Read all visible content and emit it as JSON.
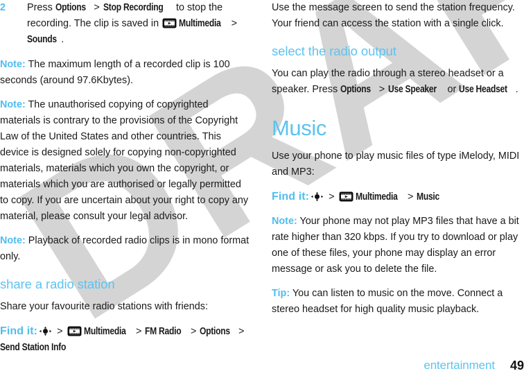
{
  "document": {
    "watermark": "DRAFT",
    "accent_blue": "#5cc3f0",
    "lead_blue": "#4fbdef",
    "body_color": "#1a1a1a",
    "watermark_color": "#d4d4d4"
  },
  "footer": {
    "chapter_name": "entertainment",
    "page_number": "49"
  },
  "left_column": {
    "step": {
      "number": "2",
      "line1_pre": "Press ",
      "line1_menu1": "Options",
      "line1_sep1": " > ",
      "line1_menu2": "Stop Recording",
      "line1_post": " to stop the recording.",
      "line2_pre": "The clip is saved in ",
      "line2_icon": "multimedia-icon",
      "line2_menu1": "Multimedia",
      "line2_sep1": " > ",
      "line2_menu2": "Sounds",
      "line2_post": "."
    },
    "note_1": {
      "lead": "Note:",
      "text": " The maximum length of a recorded clip is 100 seconds (around 97.6Kbytes)."
    },
    "note_2": {
      "lead": "Note:",
      "text": " The unauthorised copying of copyrighted materials is contrary to the provisions of the Copyright Law of the United States and other countries. This device is designed solely for copying non-copyrighted materials, materials which you own the copyright, or materials which you are authorised or legally permitted to copy. If you are uncertain about your right to copy any material, please consult your legal advisor."
    },
    "note_3": {
      "lead": "Note:",
      "text": " Playback of recorded radio clips is in mono format only."
    },
    "heading_share": "share a radio station",
    "share_intro": "Share your favourite radio stations with friends:",
    "find_it": {
      "lead": "Find it:",
      "nav_icon": "nav-key-icon",
      "sep1": " > ",
      "multimedia_icon": "multimedia-icon",
      "item1": "Multimedia",
      "sep2": " > ",
      "item2": "FM Radio",
      "sep3": " > ",
      "item3": "Options",
      "sep4": " > ",
      "item4": "Send Station Info"
    }
  },
  "right_column": {
    "share_body": "Use the message screen to send the station frequency. Your friend can access the station with a single click.",
    "heading_output": "select the radio output",
    "output_body_pre": "You can play the radio through a stereo headset or a speaker. Press ",
    "output_menu1": "Options",
    "output_sep1": " > ",
    "output_menu2": "Use Speaker",
    "output_mid": " or ",
    "output_menu3": "Use Headset",
    "output_post": ".",
    "heading_music": "Music",
    "music_intro": "Use your phone to play music files of type iMelody, MIDI and MP3:",
    "find_it": {
      "lead": "Find it:",
      "nav_icon": "nav-key-icon",
      "sep1": " > ",
      "multimedia_icon": "multimedia-icon",
      "item1": "Multimedia",
      "sep2": " > ",
      "item2": "Music"
    },
    "note_mp3": {
      "lead": "Note:",
      "text": " Your phone may not play MP3 files that have a bit rate higher than 320 kbps. If you try to download or play one of these files, your phone may display an error message or ask you to delete the file."
    },
    "tip_music": {
      "lead": "Tip:",
      "text": " You can listen to music on the move. Connect a stereo headset for high quality music playback."
    }
  }
}
